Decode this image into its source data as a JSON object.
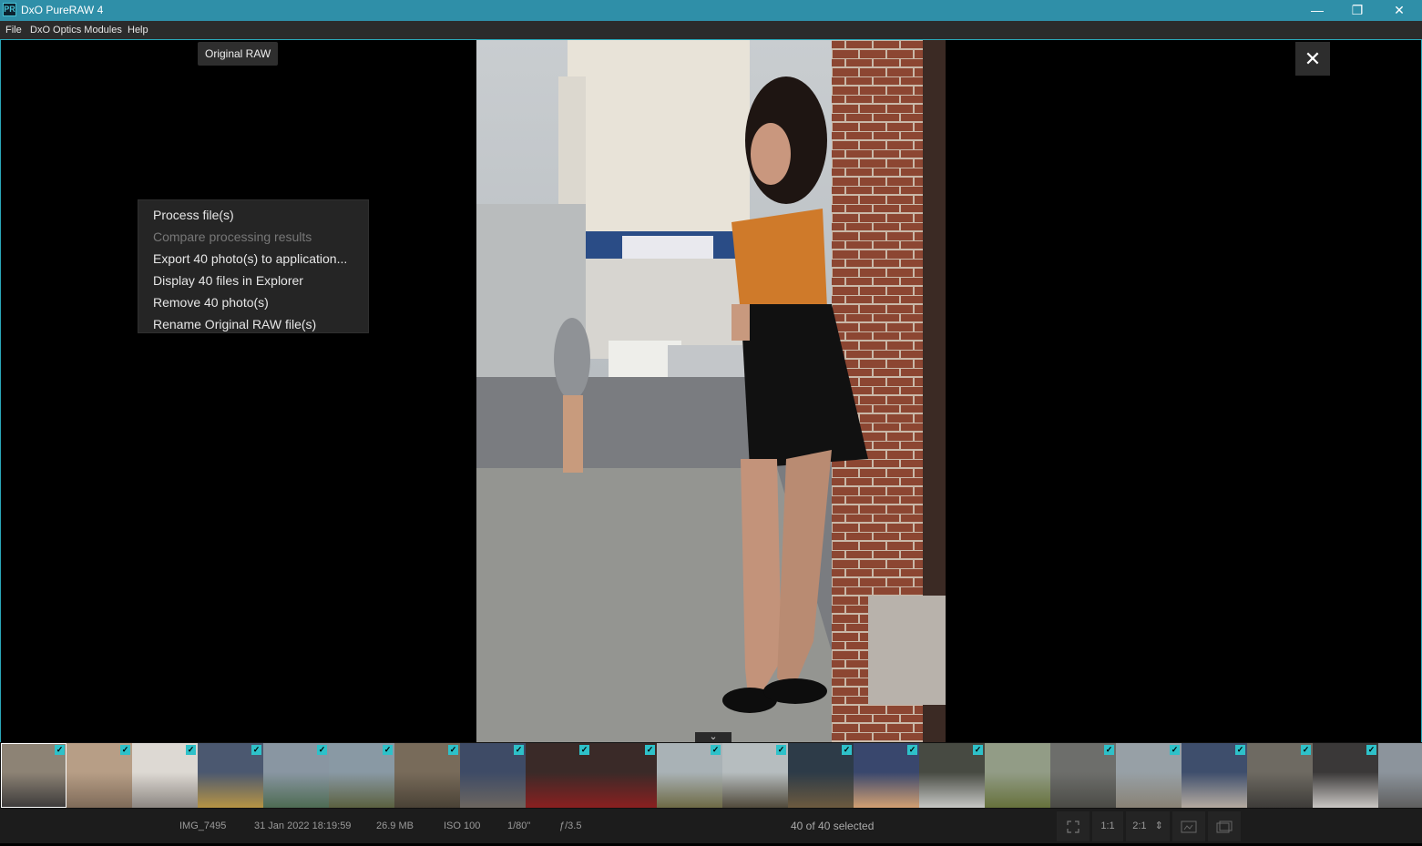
{
  "window": {
    "app_title": "DxO PureRAW 4",
    "icon_text": "PR",
    "minimize": "—",
    "restore": "❐",
    "close": "✕"
  },
  "menu": {
    "items": [
      "File",
      "DxO Optics Modules",
      "Help"
    ]
  },
  "viewer": {
    "tag": "Original RAW",
    "close": "✕",
    "collapse": "⌄"
  },
  "context_menu": {
    "items": [
      {
        "label": "Process file(s)",
        "enabled": true
      },
      {
        "label": "Compare processing results",
        "enabled": false
      },
      {
        "label": "Export 40 photo(s) to application...",
        "enabled": true
      },
      {
        "label": "Display 40 files in Explorer",
        "enabled": true
      },
      {
        "label": "Remove 40 photo(s)",
        "enabled": true
      },
      {
        "label": "Rename Original RAW file(s)",
        "enabled": true
      }
    ]
  },
  "filmstrip": {
    "check_glyph": "✓",
    "thumbs": [
      {
        "colors": [
          "#8d8375",
          "#3c3a3a"
        ],
        "checked": true,
        "active": true
      },
      {
        "colors": [
          "#b79e86",
          "#7f6b59"
        ],
        "checked": true
      },
      {
        "colors": [
          "#ddd9d3",
          "#8d8782"
        ],
        "checked": true
      },
      {
        "colors": [
          "#4b5870",
          "#b79444"
        ],
        "checked": true
      },
      {
        "colors": [
          "#8996a2",
          "#4e6b53"
        ],
        "checked": true
      },
      {
        "colors": [
          "#8999a4",
          "#5b6140"
        ],
        "checked": true
      },
      {
        "colors": [
          "#786b5a",
          "#4a4236"
        ],
        "checked": true
      },
      {
        "colors": [
          "#3e4b66",
          "#6c6660"
        ],
        "checked": true
      },
      {
        "colors": [
          "#3a2a28",
          "#8a2020"
        ],
        "checked": true
      },
      {
        "colors": [
          "#3a2a28",
          "#8a2020"
        ],
        "checked": true
      },
      {
        "colors": [
          "#a9b2b6",
          "#6e6a45"
        ],
        "checked": true
      },
      {
        "colors": [
          "#b6bdbf",
          "#514a3b"
        ],
        "checked": true
      },
      {
        "colors": [
          "#2d3b48",
          "#6c5a3f"
        ],
        "checked": true
      },
      {
        "colors": [
          "#39476d",
          "#d2a072"
        ],
        "checked": true
      },
      {
        "colors": [
          "#474a42",
          "#c6c7c4"
        ],
        "checked": true
      },
      {
        "colors": [
          "#929c86",
          "#66713c"
        ],
        "checked": false
      },
      {
        "colors": [
          "#6d6e6b",
          "#4b4b46"
        ],
        "checked": true
      },
      {
        "colors": [
          "#97a0a6",
          "#898275"
        ],
        "checked": true
      },
      {
        "colors": [
          "#3e4e6c",
          "#b5aba0"
        ],
        "checked": true
      },
      {
        "colors": [
          "#6e6a62",
          "#3e3c39"
        ],
        "checked": true
      },
      {
        "colors": [
          "#3a3838",
          "#c9c6c3"
        ],
        "checked": true
      },
      {
        "colors": [
          "#8c949c",
          "#5f5f5f"
        ],
        "checked": false
      }
    ]
  },
  "status": {
    "filename": "IMG_7495",
    "date": "31 Jan 2022 18:19:59",
    "size": "26.9 MB",
    "iso": "ISO 100",
    "shutter": "1/80\"",
    "aperture": "ƒ/3.5",
    "selected": "40 of 40 selected",
    "zoom_1": "1:1",
    "zoom_2": "2:1",
    "zoom_2_arrows": "⇕"
  },
  "colors": {
    "accent": "#2aa7b8",
    "titlebar": "#2f8fa8",
    "check": "#2ec1c9"
  }
}
